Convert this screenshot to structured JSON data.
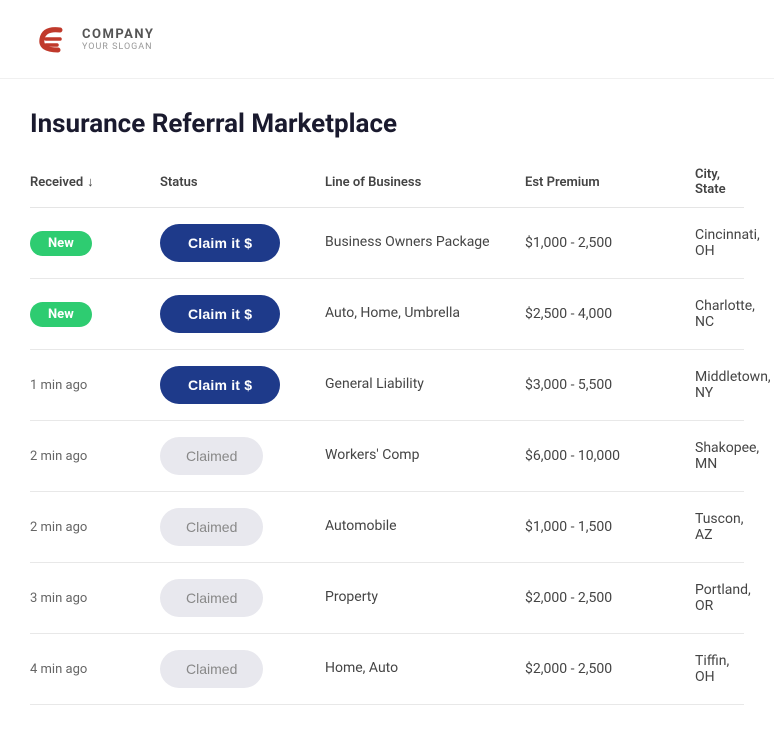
{
  "header": {
    "company_name": "COMPANY",
    "slogan": "YOUR SLOGAN"
  },
  "page": {
    "title": "Insurance Referral Marketplace"
  },
  "table": {
    "columns": [
      {
        "label": "Received",
        "sort_icon": "↓"
      },
      {
        "label": "Status"
      },
      {
        "label": "Line of Business"
      },
      {
        "label": "Est Premium"
      },
      {
        "label": "City, State"
      }
    ],
    "rows": [
      {
        "received": "New",
        "received_type": "badge",
        "status": "Claim it $",
        "status_type": "claim",
        "line_of_business": "Business Owners Package",
        "est_premium": "$1,000 - 2,500",
        "city_state": "Cincinnati, OH"
      },
      {
        "received": "New",
        "received_type": "badge",
        "status": "Claim it $",
        "status_type": "claim",
        "line_of_business": "Auto, Home, Umbrella",
        "est_premium": "$2,500 - 4,000",
        "city_state": "Charlotte, NC"
      },
      {
        "received": "1 min ago",
        "received_type": "time",
        "status": "Claim it $",
        "status_type": "claim",
        "line_of_business": "General Liability",
        "est_premium": "$3,000 - 5,500",
        "city_state": "Middletown, NY"
      },
      {
        "received": "2 min ago",
        "received_type": "time",
        "status": "Claimed",
        "status_type": "claimed",
        "line_of_business": "Workers' Comp",
        "est_premium": "$6,000 - 10,000",
        "city_state": "Shakopee, MN"
      },
      {
        "received": "2 min ago",
        "received_type": "time",
        "status": "Claimed",
        "status_type": "claimed",
        "line_of_business": "Automobile",
        "est_premium": "$1,000 - 1,500",
        "city_state": "Tuscon, AZ"
      },
      {
        "received": "3 min ago",
        "received_type": "time",
        "status": "Claimed",
        "status_type": "claimed",
        "line_of_business": "Property",
        "est_premium": "$2,000 - 2,500",
        "city_state": "Portland, OR"
      },
      {
        "received": "4 min ago",
        "received_type": "time",
        "status": "Claimed",
        "status_type": "claimed",
        "line_of_business": "Home, Auto",
        "est_premium": "$2,000 - 2,500",
        "city_state": "Tiffin, OH"
      }
    ]
  }
}
